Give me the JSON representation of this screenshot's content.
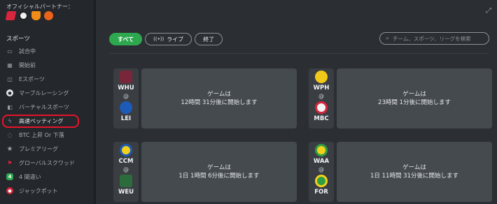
{
  "sidebar": {
    "partners_label": "オフィシャルパートナー：",
    "section_title": "スポーツ",
    "items": [
      {
        "label": "試合中",
        "icon": "monitor-icon"
      },
      {
        "label": "開始前",
        "icon": "calendar-icon"
      },
      {
        "label": "Eスポーツ",
        "icon": "gamepad-icon"
      },
      {
        "label": "マーブルレーシング",
        "icon": "marble-icon"
      },
      {
        "label": "バーチャルスポーツ",
        "icon": "virtual-icon"
      },
      {
        "label": "高速ベッティング",
        "icon": "lightning-icon"
      },
      {
        "label": "BTC 上昇 Or 下落",
        "icon": "bitcoin-icon"
      },
      {
        "label": "プレミアリーグ",
        "icon": "star-icon"
      },
      {
        "label": "グローバルスクワッド",
        "icon": "squad-icon"
      },
      {
        "label": "4 間違い",
        "icon": "four-icon"
      },
      {
        "label": "ジャックポット",
        "icon": "jackpot-icon"
      }
    ]
  },
  "filters": {
    "all": "すべて",
    "live": "ライブ",
    "finished": "終了"
  },
  "search": {
    "placeholder": "チーム、スポーツ、リーグを検索"
  },
  "matches": [
    {
      "home": "WHU",
      "away": "LEI",
      "line1": "ゲームは",
      "line2": "12時間 31分後に開始します",
      "home_color": "#7a263a",
      "away_color": "#1d5bb8"
    },
    {
      "home": "WPH",
      "away": "MBC",
      "line1": "ゲームは",
      "line2": "23時間 1分後に開始します",
      "home_color": "#f2c81a",
      "away_color": "#f5f5f5"
    },
    {
      "home": "CCM",
      "away": "WEU",
      "line1": "ゲームは",
      "line2": "1日 1時間 6分後に開始します",
      "home_color": "#f2d11a",
      "away_color": "#2b6b3c"
    },
    {
      "home": "WAA",
      "away": "FOR",
      "line1": "ゲームは",
      "line2": "1日 11時間 31分後に開始します",
      "home_color": "#f2d11a",
      "away_color": "#2f9d46"
    }
  ],
  "colors": {
    "accent": "#2ea84f",
    "highlight": "#e8132a"
  }
}
